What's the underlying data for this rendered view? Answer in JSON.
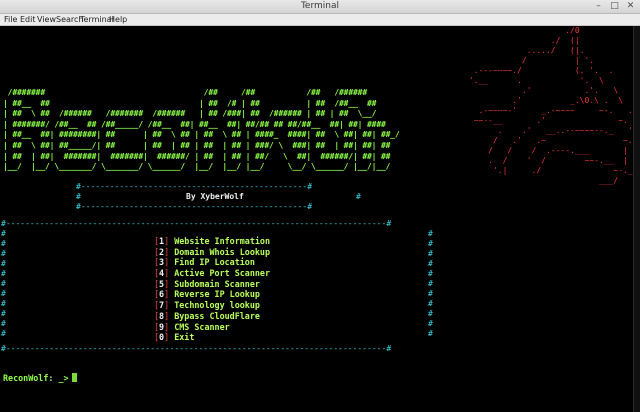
{
  "window": {
    "title": "Terminal",
    "controls": {
      "minimize": "–",
      "maximize": "□",
      "close": "✕"
    }
  },
  "menubar": {
    "items": [
      "File",
      "Edit",
      "View",
      "Search",
      "Terminal",
      "Help"
    ]
  },
  "banner": {
    "ascii_lines": [
      " /#######                                  /##     /##           /##   /######",
      "| ##__  ##                                | ##  /# | ##          | ##  /##__  ##",
      "| ##  \\ ##  /######   /#######  /######   | ## /###| ##  /###### | ## | ##  \\__/",
      "| #######/ /##__  ## /##_____/ /##__  ##| ##__  ##| ##/## ## ##/##__  ##| ##| ####",
      "| ##__  ##| ########| ##      | ##  \\ ## | ##  \\ ## | ####_  ####| ##  \\ ##| ##| ##_/",
      "| ##  \\ ##| ##_____/| ##      | ##  | ## | ##  | ## | ###/ \\  ###| ##  | ##| ##| ##",
      "| ##  | ##|  #######|  #######|  ######/ | ##  | ## | ##/   \\  ##|  ######/| ##| ##",
      "|__/  |__/ \\_______/ \\_______/ \\______/  |__/  |__/ |__/     \\__/ \\______/ |__/|__/"
    ],
    "wolf_lines": [
      "                          ./0",
      "                       ./  (|",
      "                  ...../   (|.",
      "                 /          | '.",
      "       .---~~~~./           (. '.  .",
      "      '.__      .            '.  \\",
      "                 .'           .'.   \\",
      "               .'          _.\\0.\\ .  \\",
      "        .-~~~~-'     _.-~~~~     ~-.   .",
      "       ~~--__       .'               ~.  |",
      "            .    .'   __..--~~~~--._   '. |",
      "           /   .'   .~                ~.   '_",
      "          /   /    /  .----.___       |    '|",
      "          .  /    '  /        ~~-.__  |     |",
      "           '.|     ./               ~-._.-'",
      "                                 ___/   ."
    ]
  },
  "credit_box": {
    "border": "#-----------------------------------------------#",
    "side": "#",
    "text": "By XyberWolf"
  },
  "menu_box": {
    "border": "#-------------------------------------------------------------------------------#",
    "side": "#",
    "items": [
      {
        "num": "1",
        "label": "Website Information"
      },
      {
        "num": "2",
        "label": "Domain Whois Lookup"
      },
      {
        "num": "3",
        "label": "Find IP Location"
      },
      {
        "num": "4",
        "label": "Active Port Scanner"
      },
      {
        "num": "5",
        "label": "Subdomain Scanner"
      },
      {
        "num": "6",
        "label": "Reverse IP Lookup"
      },
      {
        "num": "7",
        "label": "Technology lookup"
      },
      {
        "num": "8",
        "label": "Bypass CloudFlare"
      },
      {
        "num": "9",
        "label": "CMS Scanner"
      },
      {
        "num": "0",
        "label": "Exit"
      }
    ]
  },
  "prompt": {
    "text": "ReconWolf: _>"
  },
  "colors": {
    "background": "#000000",
    "banner_green": "#8fff4a",
    "menu_label_green": "#b8ff5a",
    "border_cyan": "#3ad8ea",
    "bracket_red": "#f04444",
    "wolf_red": "#f23a3a"
  }
}
